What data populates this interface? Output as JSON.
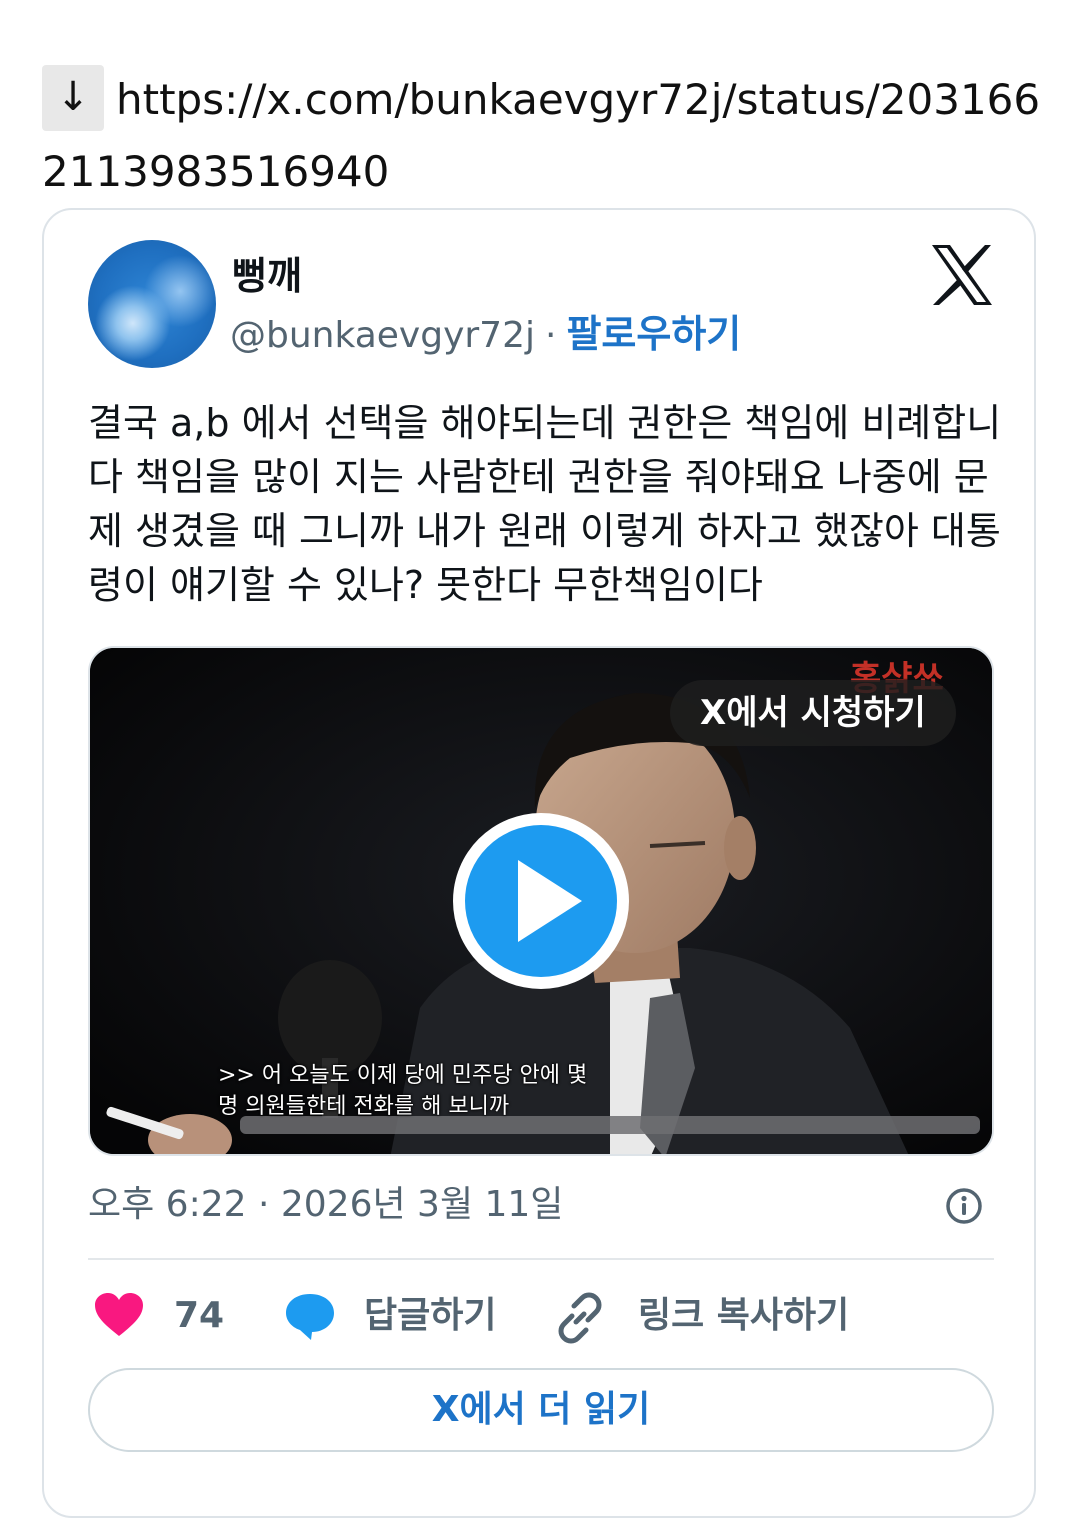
{
  "link": {
    "arrow": "↓",
    "url": "https://x.com/bunkaevgyr72j/status/2031662113983516940"
  },
  "tweet": {
    "display_name": "뻥깨",
    "handle": "@bunkaevgyr72j",
    "separator": "·",
    "follow_label": "팔로우하기",
    "brand_icon": "x-logo-icon",
    "text": "결국 a,b 에서 선택을 해야되는데 권한은 책임에 비례합니다 책임을 많이 지는 사람한테 권한을 줘야돼요 나중에 문제 생겼을 때 그니까 내가 원래 이렇게 하자고 했잖아 대통령이 얘기할 수 있나? 못한다 무한책임이다",
    "video": {
      "watch_label": "X에서 시청하기",
      "subtitle_line1": ">> 어 오늘도 이제 당에 민주당 안에 몇",
      "subtitle_line2": "명 의원들한테 전화를 해 보니까"
    },
    "timestamp": "오후 6:22 · 2026년 3월 11일",
    "likes": "74",
    "reply_label": "답글하기",
    "copy_link_label": "링크 복사하기",
    "read_more_label": "X에서 더 읽기"
  },
  "colors": {
    "accent": "#1d73c8",
    "like": "#f91880",
    "reply": "#1d9bf0",
    "muted": "#536471",
    "play": "#1d9bf0"
  }
}
